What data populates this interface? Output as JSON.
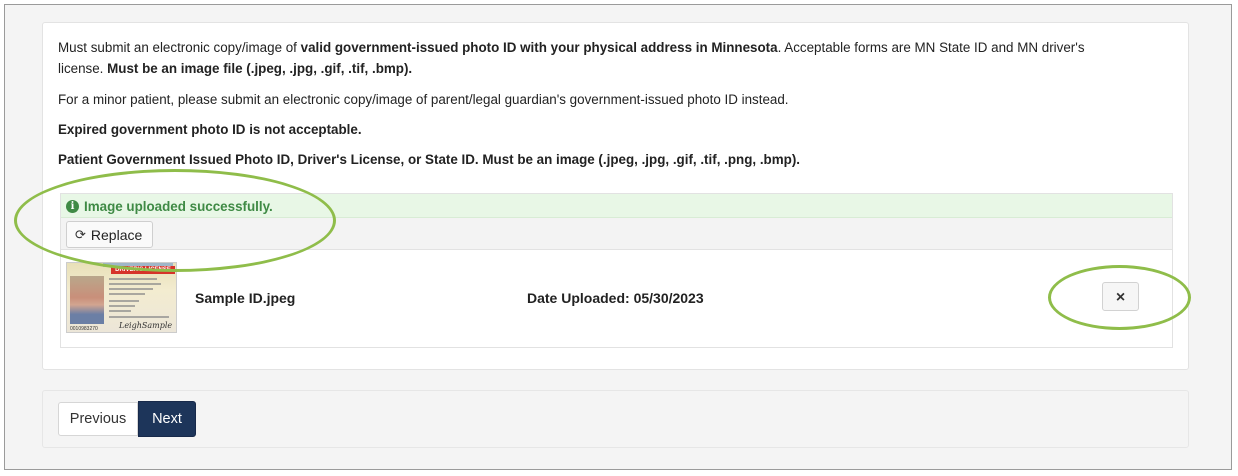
{
  "instructions": {
    "p1_a": "Must submit an electronic copy/image of ",
    "p1_b": "valid government-issued photo ID with your physical address in Minnesota",
    "p1_c": ". Acceptable forms are MN State ID and MN driver's",
    "p1_d": "license. ",
    "p1_e": "Must be an image file (.jpeg, .jpg, .gif, .tif, .bmp).",
    "p2": "For a minor patient, please submit an electronic copy/image of parent/legal guardian's government-issued photo ID instead.",
    "p3": "Expired government photo ID is not acceptable.",
    "p4": "Patient Government Issued Photo ID, Driver's License, or State ID. Must be an image (.jpeg, .jpg, .gif, .tif, .png, .bmp)."
  },
  "upload": {
    "success_icon": "i",
    "success_message": "Image uploaded successfully.",
    "replace_label": "Replace",
    "file_name": "Sample ID.jpeg",
    "date_uploaded": "Date Uploaded: 05/30/2023",
    "remove_label": "×",
    "thumbnail": {
      "banner": "DRIVER'S LICENSE",
      "signature": "LeighSample",
      "number": "0010983270"
    }
  },
  "navigation": {
    "previous_label": "Previous",
    "next_label": "Next"
  },
  "colors": {
    "success_green": "#3f8a45",
    "success_bg": "#e8f7e6",
    "next_button": "#1d355a",
    "highlight": "#8fbd4a"
  }
}
